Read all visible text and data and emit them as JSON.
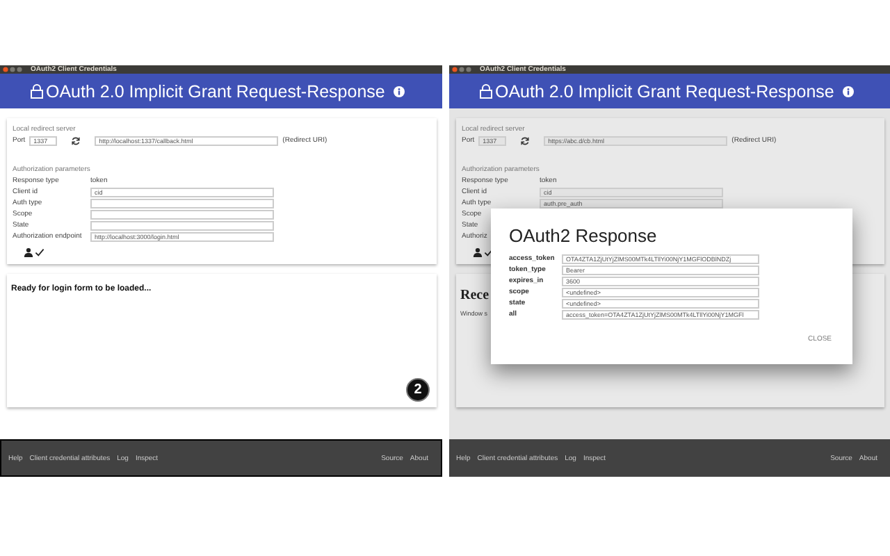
{
  "windows": [
    {
      "title": "OAuth2 Client Credentials",
      "heading": "OAuth 2.0 Implicit Grant Request-Response",
      "focused": true,
      "dimmed": false,
      "redirect": {
        "section": "Local redirect server",
        "port_label": "Port",
        "port": "1337",
        "uri": "http://localhost:1337/callback.html",
        "uri_label": "(Redirect URI)"
      },
      "params": {
        "section": "Authorization parameters",
        "rows": [
          {
            "label": "Response type",
            "kind": "text",
            "value": "token"
          },
          {
            "label": "Client id",
            "kind": "field",
            "value": "cid"
          },
          {
            "label": "Auth type",
            "kind": "field",
            "value": ""
          },
          {
            "label": "Scope",
            "kind": "field",
            "value": ""
          },
          {
            "label": "State",
            "kind": "field",
            "value": ""
          },
          {
            "label": "Authorization endpoint",
            "kind": "field",
            "value": "http://localhost:3000/login.html"
          }
        ]
      },
      "result": [
        {
          "kind": "status",
          "text": "Ready for login form to be loaded..."
        },
        {
          "kind": "badge",
          "text": "2"
        }
      ],
      "footer": {
        "left": [
          "Help",
          "Client credential attributes",
          "Log",
          "Inspect"
        ],
        "right": [
          "Source",
          "About"
        ]
      }
    },
    {
      "title": "OAuth2 Client Credentials",
      "heading": "OAuth 2.0 Implicit Grant Request-Response",
      "focused": false,
      "dimmed": true,
      "redirect": {
        "section": "Local redirect server",
        "port_label": "Port",
        "port": "1337",
        "uri": "https://abc.d/cb.html",
        "uri_label": "(Redirect URI)"
      },
      "params": {
        "section": "Authorization parameters",
        "rows": [
          {
            "label": "Response type",
            "kind": "text",
            "value": "token"
          },
          {
            "label": "Client id",
            "kind": "field",
            "value": "cid"
          },
          {
            "label": "Auth type",
            "kind": "field",
            "value": "auth.pre_auth"
          },
          {
            "label": "Scope",
            "kind": "label"
          },
          {
            "label": "State",
            "kind": "label"
          },
          {
            "label": "Authoriz",
            "kind": "label"
          }
        ]
      },
      "result": [
        {
          "kind": "heading",
          "text": "Rece"
        },
        {
          "kind": "note",
          "text": "Window s"
        }
      ],
      "dialog": {
        "title": "OAuth2 Response",
        "rows": [
          {
            "label": "access_token",
            "value": "OTA4ZTA1ZjUtYjZlMS00MTk4LTllYi00NjY1MGFlODBlNDZj"
          },
          {
            "label": "token_type",
            "value": "Bearer"
          },
          {
            "label": "expires_in",
            "value": "3600"
          },
          {
            "label": "scope",
            "value": "<undefined>"
          },
          {
            "label": "state",
            "value": "<undefined>"
          },
          {
            "label": "all",
            "value": "access_token=OTA4ZTA1ZjUtYjZlMS00MTk4LTllYi00NjY1MGFl"
          }
        ],
        "close": "CLOSE"
      },
      "footer": {
        "left": [
          "Help",
          "Client credential attributes",
          "Log",
          "Inspect"
        ],
        "right": [
          "Source",
          "About"
        ]
      }
    }
  ]
}
